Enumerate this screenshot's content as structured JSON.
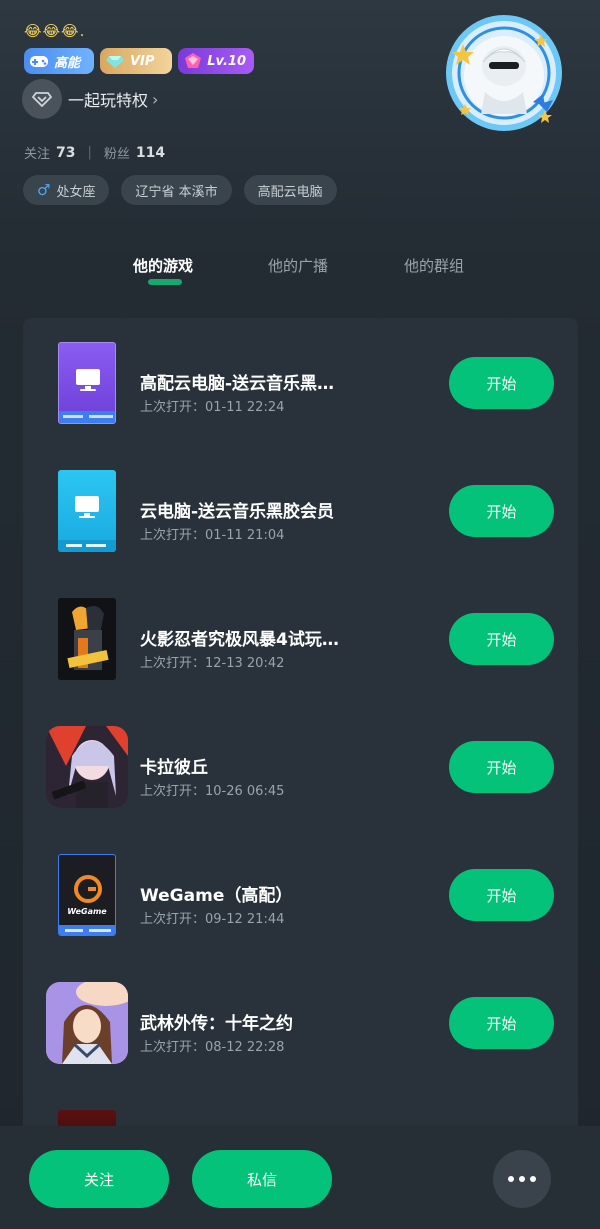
{
  "profile": {
    "emoji": "😂😂😂.",
    "badges": [
      {
        "label": "高能",
        "color": "#4a8df0"
      },
      {
        "label": "VIP",
        "color": "#e0b36e"
      },
      {
        "label": "Lv.10",
        "color": "#8c46e6"
      }
    ],
    "privilege_label": "一起玩特权",
    "following_label": "关注",
    "following_count": "73",
    "fans_label": "粉丝",
    "fans_count": "114",
    "tags": [
      "处女座",
      "辽宁省 本溪市",
      "高配云电脑"
    ]
  },
  "tabs": [
    {
      "label": "他的游戏",
      "active": true
    },
    {
      "label": "他的广播",
      "active": false
    },
    {
      "label": "他的群组",
      "active": false
    }
  ],
  "games": [
    {
      "title": "高配云电脑-送云音乐黑…",
      "last_open": "上次打开：01-11 22:24",
      "button": "开始",
      "icon": "monitor-icon-purple"
    },
    {
      "title": "云电脑-送云音乐黑胶会员",
      "last_open": "上次打开：01-11 21:04",
      "button": "开始",
      "icon": "monitor-icon-cyan"
    },
    {
      "title": "火影忍者究极风暴4试玩…",
      "last_open": "上次打开：12-13 20:42",
      "button": "开始",
      "icon": "naruto-cover"
    },
    {
      "title": "卡拉彼丘",
      "last_open": "上次打开：10-26 06:45",
      "button": "开始",
      "icon": "strinova-icon"
    },
    {
      "title": "WeGame（高配）",
      "last_open": "上次打开：09-12 21:44",
      "button": "开始",
      "icon": "wegame-logo",
      "logo_text": "WeGame"
    },
    {
      "title": "武林外传：十年之约",
      "last_open": "上次打开：08-12 22:28",
      "button": "开始",
      "icon": "wulin-icon"
    }
  ],
  "bottom": {
    "follow_label": "关注",
    "message_label": "私信",
    "more_icon": "more-dots-icon"
  },
  "colors": {
    "accent": "#05c27a",
    "background": "#232b33",
    "panel": "#29313a"
  }
}
